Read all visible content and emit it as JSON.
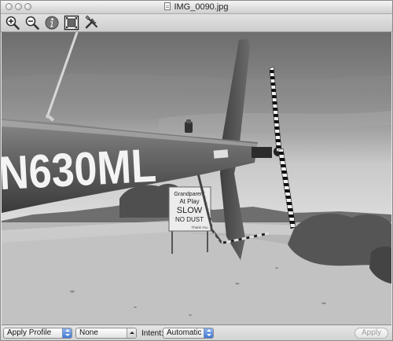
{
  "window": {
    "title": "IMG_0090.jpg"
  },
  "toolbar": {
    "tools": [
      {
        "icon": "zoom-in-icon"
      },
      {
        "icon": "zoom-out-icon"
      },
      {
        "icon": "info-icon"
      },
      {
        "icon": "fit-to-window-icon"
      },
      {
        "icon": "adjust-tools-icon"
      }
    ]
  },
  "image": {
    "tail_number": "N630ML",
    "sign_lines": [
      "Grandparent",
      "At Play",
      "SLOW",
      "NO DUST",
      "Thank You"
    ]
  },
  "bottombar": {
    "profile_menu": "Apply Profile",
    "profile_value": "None",
    "intent_label": "Intent:",
    "intent_value": "Automatic",
    "apply_label": "Apply"
  },
  "colors": {
    "select_accent": "#3f78d3",
    "disabled_text": "#9c9c9c"
  }
}
